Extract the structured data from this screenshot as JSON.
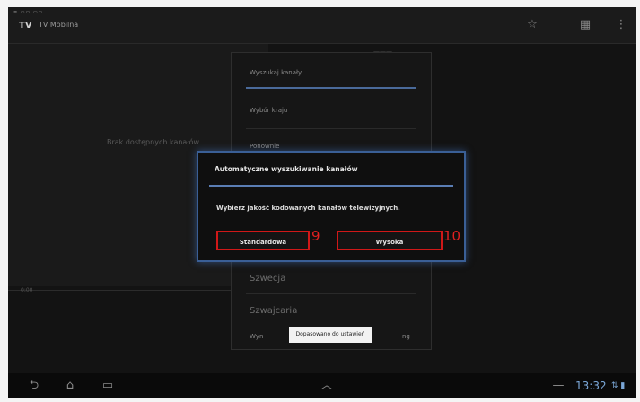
{
  "statusbar": {
    "indicators": "≡ ▭▭ ▭▭"
  },
  "app": {
    "logo": "TV",
    "title": "TV Mobilna"
  },
  "actionbar": {
    "icons": [
      "star-icon",
      "calendar-icon",
      "overflow-icon"
    ],
    "glyphs": [
      "☆",
      "▦",
      "⋮"
    ]
  },
  "background": {
    "empty_text": "Brak dostępnych kanałów",
    "small_label": "0:00",
    "right_header": "———"
  },
  "menu": {
    "title": "Wyszukaj kanały",
    "items": [
      "Wybór kraju",
      "Ponownie"
    ],
    "countries": [
      "Szwecja",
      "Szwajcaria"
    ],
    "bottom_prefix": "Wyn",
    "bottom_suffix": "ng"
  },
  "toast": {
    "text": "Dopasowano do ustawień"
  },
  "dialog": {
    "title": "Automatyczne wyszukiwanie kanałów",
    "message": "Wybierz jakość kodowanych kanałów telewizyjnych.",
    "buttons": [
      {
        "label": "Standardowa",
        "annotation": "9"
      },
      {
        "label": "Wysoka",
        "annotation": "10"
      }
    ]
  },
  "navbar": {
    "glyphs": [
      "⮌",
      "⌂",
      "▭",
      "︿",
      "—"
    ],
    "time": "13:32",
    "sys_icons": "⇅ ▮"
  },
  "colors": {
    "dialog_border": "#3a5f96",
    "annotation_red": "#d01818",
    "clock_blue": "#7aa6d6"
  }
}
